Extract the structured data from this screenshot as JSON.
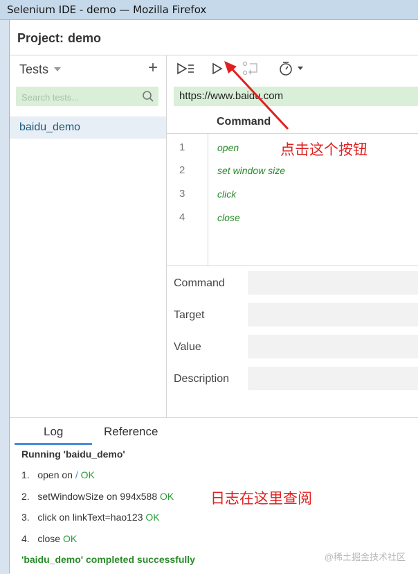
{
  "window": {
    "title": "Selenium IDE - demo — Mozilla Firefox"
  },
  "project": {
    "label": "Project:",
    "name": "demo"
  },
  "sidebar": {
    "heading": "Tests",
    "search_placeholder": "Search tests...",
    "tests": [
      {
        "label": "baidu_demo",
        "selected": true
      }
    ]
  },
  "toolbar": {
    "buttons": [
      "run-all-icon",
      "run-current-icon",
      "step-over-icon",
      "timer-icon"
    ]
  },
  "url_bar": {
    "value": "https://www.baidu.com"
  },
  "commands_table": {
    "header": "Command",
    "rows": [
      {
        "num": "1",
        "command": "open"
      },
      {
        "num": "2",
        "command": "set window size"
      },
      {
        "num": "3",
        "command": "click"
      },
      {
        "num": "4",
        "command": "close"
      }
    ]
  },
  "editor": {
    "command_label": "Command",
    "target_label": "Target",
    "value_label": "Value",
    "description_label": "Description"
  },
  "bottom_panel": {
    "tabs": [
      "Log",
      "Reference"
    ],
    "active_tab": "Log",
    "running": "Running 'baidu_demo'",
    "log": [
      {
        "num": "1.",
        "pre": "open on ",
        "target": "/",
        "ok": "OK"
      },
      {
        "num": "2.",
        "pre": "setWindowSize on 994x588 ",
        "target": "",
        "ok": "OK"
      },
      {
        "num": "3.",
        "pre": "click on linkText=hao123 ",
        "target": "",
        "ok": "OK"
      },
      {
        "num": "4.",
        "pre": "close ",
        "target": "",
        "ok": "OK"
      }
    ],
    "completed": "'baidu_demo' completed successfully"
  },
  "annotations": {
    "click_button": "点击这个按钮",
    "view_log": "日志在这里查阅"
  },
  "watermark": "@稀土掘金技术社区",
  "colors": {
    "accent_green": "#2b8a2b",
    "annotation_red": "#e02020",
    "tab_blue": "#4a90d9"
  }
}
